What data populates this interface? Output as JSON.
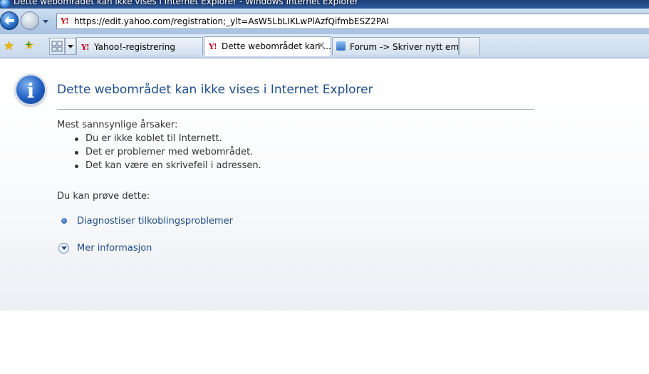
{
  "window": {
    "title": "Dette webområdet kan ikke vises i Internet Explorer - Windows Internet Explorer"
  },
  "address_bar": {
    "url": "https://edit.yahoo.com/registration;_ylt=AsW5LbLIKLwPlAzfQifmbESZ2PAI",
    "site_icon": "yahoo-y-icon"
  },
  "tabs": [
    {
      "label": "Yahoo!-registrering",
      "icon": "yahoo-y-icon",
      "active": false
    },
    {
      "label": "Dette webområdet kan ...",
      "icon": "yahoo-y-icon",
      "active": true
    },
    {
      "label": "Forum -> Skriver nytt emn...",
      "icon": "forum-v-icon",
      "active": false
    }
  ],
  "close_tab_glyph": "×",
  "content": {
    "title": "Dette webområdet kan ikke vises i Internet Explorer",
    "causes_heading": "Mest sannsynlige årsaker:",
    "causes": [
      "Du er ikke koblet til Internett.",
      "Det er problemer med webområdet.",
      "Det kan være en skrivefeil i adressen."
    ],
    "try_heading": "Du kan prøve dette:",
    "diagnose_link": "Diagnostiser tilkoblingsproblemer",
    "more_info_link": "Mer informasjon"
  },
  "colors": {
    "title_blue": "#1f4e8a",
    "link_blue": "#1f4e8a",
    "yahoo_red": "#c4001c"
  }
}
